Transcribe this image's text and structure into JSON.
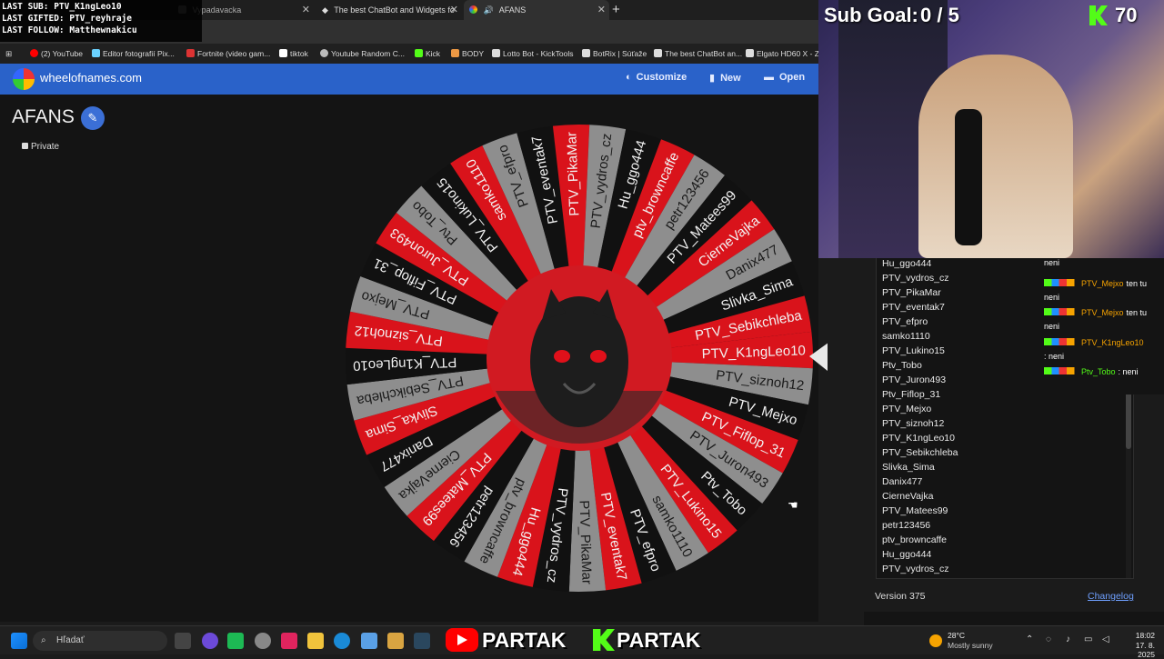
{
  "overlay": {
    "last_sub": "LAST SUB: PTV_K1ngLeo10",
    "last_gifted": "LAST GIFTED: PTV_reyhraje",
    "last_follow": "LAST FOLLOW: Matthewnakicu"
  },
  "tabs": [
    {
      "label": "Vypadavacka"
    },
    {
      "label": "The best ChatBot and Widgets fo"
    },
    {
      "label": "AFANS"
    }
  ],
  "new_tab_glyph": "+",
  "bookmarks": [
    {
      "label": "(2) YouTube",
      "color": "#ff0000"
    },
    {
      "label": "Editor fotografií Pix...",
      "color": "#6ad2ff"
    },
    {
      "label": "Fortnite (video gam...",
      "color": "#d33"
    },
    {
      "label": "tiktok",
      "color": "#fff"
    },
    {
      "label": "Youtube Random C...",
      "color": "#bbb"
    },
    {
      "label": "Kick",
      "color": "#53fc18"
    },
    {
      "label": "BODY",
      "color": "#e94"
    },
    {
      "label": "Lotto Bot - KickTools",
      "color": "#ddd"
    },
    {
      "label": "BotRix | Súťaže",
      "color": "#ddd"
    },
    {
      "label": "The best ChatBot an...",
      "color": "#ddd"
    },
    {
      "label": "Elgato HD60 X - Ze...",
      "color": "#ddd"
    }
  ],
  "site": {
    "name": "wheelofnames.com",
    "customize": "Customize",
    "new": "New",
    "open": "Open"
  },
  "wheel_title": "AFANS",
  "private_label": "Private",
  "wheel": {
    "names": [
      "PTV_K1ngLeo10",
      "PTV_siznoh12",
      "PTV_Mejxo",
      "PTV_Fiflop_31",
      "PTV_Juron493",
      "Ptv_Tobo",
      "PTV_Lukino15",
      "samko1110",
      "PTV_efpro",
      "PTV_eventak7",
      "PTV_PikaMar",
      "PTV_vydros_cz",
      "Hu_ggo444",
      "ptv_browncaffe",
      "petr123456",
      "PTV_Matees99",
      "CierneVajka",
      "Danix477",
      "Slivka_Sima",
      "PTV_Sebikchleba",
      "PTV_K1ngLeo10",
      "PTV_siznoh12",
      "PTV_Mejxo",
      "PTV_Fiflop_31",
      "PTV_Juron493",
      "Ptv_Tobo",
      "PTV_Lukino15",
      "samko1110",
      "PTV_efpro",
      "PTV_eventak7",
      "PTV_PikaMar",
      "PTV_vydros_cz",
      "Hu_ggo444",
      "ptv_browncaffe",
      "petr123456",
      "PTV_Matees99",
      "CierneVajka",
      "Danix477",
      "Slivka_Sima",
      "PTV_Sebikchleba"
    ],
    "colors": [
      "#d9131b",
      "#8e8e8e",
      "#111111"
    ]
  },
  "sub_goal": {
    "label": "Sub Goal:",
    "value": "0 / 5",
    "kick_count": "70"
  },
  "entries": [
    "Hu_ggo444",
    "PTV_vydros_cz",
    "PTV_PikaMar",
    "PTV_eventak7",
    "PTV_efpro",
    "samko1110",
    "PTV_Lukino15",
    "Ptv_Tobo",
    "PTV_Juron493",
    "Ptv_Fiflop_31",
    "PTV_Mejxo",
    "PTV_siznoh12",
    "PTV_K1ngLeo10",
    "PTV_Sebikchleba",
    "Slivka_Sima",
    "Danix477",
    "CierneVajka",
    "PTV_Matees99",
    "petr123456",
    "ptv_browncaffe",
    "Hu_ggo444",
    "PTV_vydros_cz"
  ],
  "chat": [
    {
      "user": "",
      "text": "neni"
    },
    {
      "user": "PTV_Mejxo",
      "text": "ten tu"
    },
    {
      "user": "",
      "text": "neni"
    },
    {
      "user": "PTV_Mejxo",
      "text": "ten tu"
    },
    {
      "user": "",
      "text": "neni"
    },
    {
      "user": "PTV_K1ngLeo10",
      "text": ""
    },
    {
      "user": "",
      "text": ": neni"
    },
    {
      "user": "Ptv_Tobo",
      "text": ": neni"
    }
  ],
  "version": "Version 375",
  "changelog": "Changelog",
  "taskbar": {
    "search": "Hľadať",
    "weather_temp": "28°C",
    "weather_desc": "Mostly sunny",
    "time": "18:02",
    "date": "17. 8. 2025",
    "partak_yt": "PARTAK",
    "partak_kick": "PARTAK"
  }
}
